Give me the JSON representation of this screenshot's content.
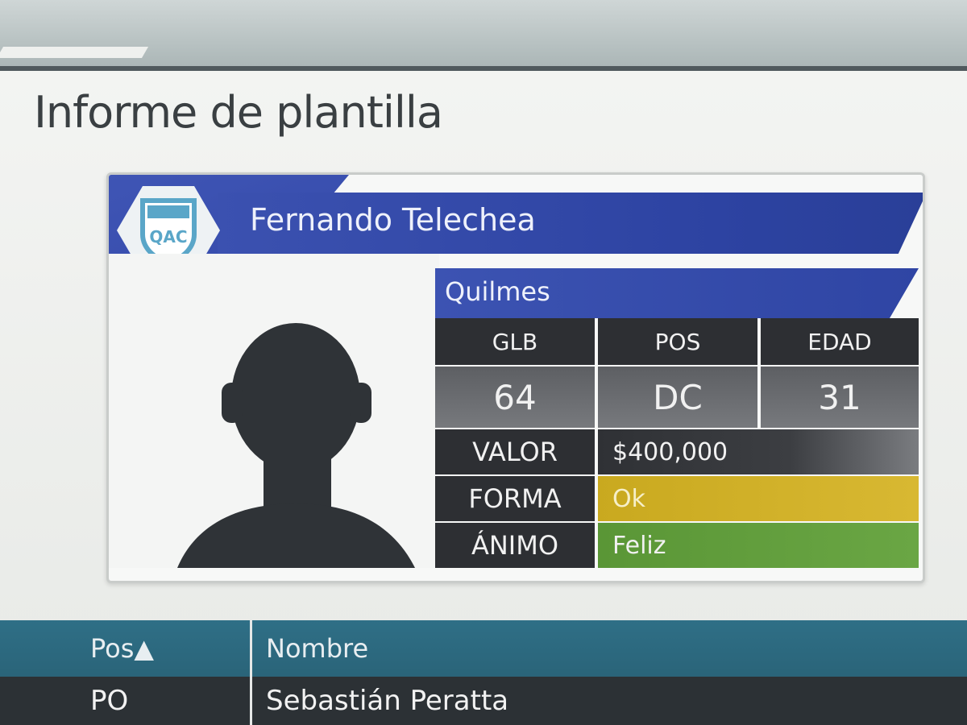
{
  "page": {
    "title": "Informe de plantilla"
  },
  "player": {
    "name": "Fernando Telechea",
    "club": "Quilmes",
    "club_badge_text": "QAC",
    "stats_headers": {
      "glb": "GLB",
      "pos": "POS",
      "edad": "EDAD"
    },
    "stats_values": {
      "glb": "64",
      "pos": "DC",
      "edad": "31"
    },
    "rows": {
      "valor_label": "VALOR",
      "valor": "$400,000",
      "forma_label": "FORMA",
      "forma": "Ok",
      "animo_label": "ÁNIMO",
      "animo": "Feliz"
    }
  },
  "colors": {
    "card_blue": "#2f45a4",
    "forma_yellow": "#d2b12a",
    "animo_green": "#5f9a3a",
    "table_header": "#2f6f86"
  },
  "table": {
    "columns": {
      "pos": "Pos",
      "sort_indicator": "▲",
      "nombre": "Nombre"
    },
    "rows": [
      {
        "pos": "PO",
        "nombre": "Sebastián Peratta"
      }
    ]
  }
}
